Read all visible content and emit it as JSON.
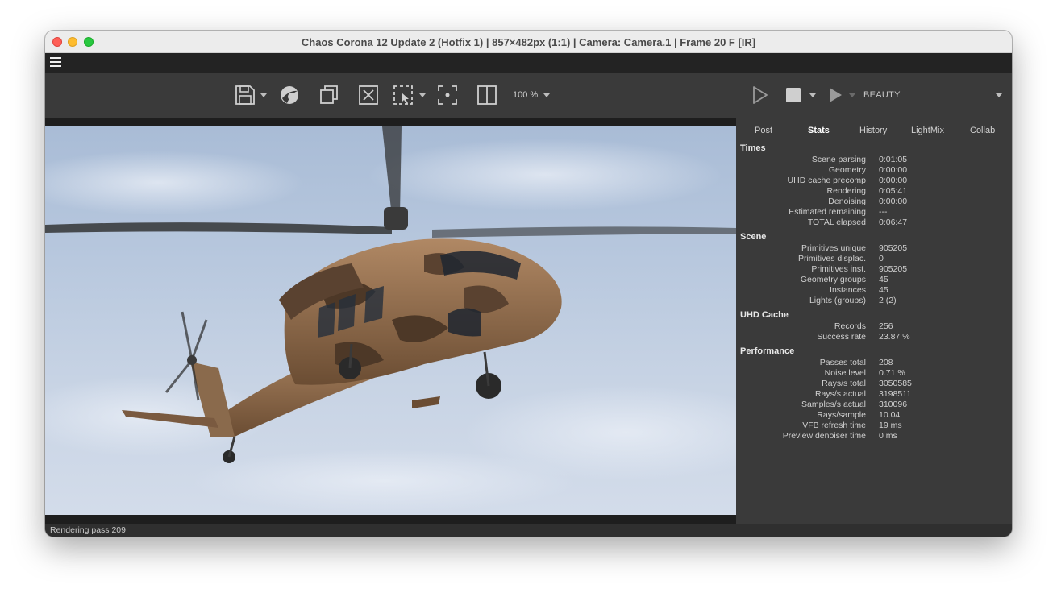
{
  "window": {
    "title": "Chaos Corona 12 Update 2 (Hotfix 1) | 857×482px (1:1) | Camera: Camera.1 | Frame 20 F [IR]"
  },
  "toolbar": {
    "icons": [
      "save-icon",
      "corona-logo-icon",
      "copy-icon",
      "clear-icon",
      "region-select-icon",
      "focus-point-icon",
      "split-view-icon"
    ],
    "zoom": "100 %",
    "render_icons": [
      "play-outline-icon",
      "stop-icon",
      "play-icon"
    ],
    "pass": "BEAUTY"
  },
  "tabs": [
    {
      "label": "Post",
      "active": false
    },
    {
      "label": "Stats",
      "active": true
    },
    {
      "label": "History",
      "active": false
    },
    {
      "label": "LightMix",
      "active": false
    },
    {
      "label": "Collab",
      "active": false
    }
  ],
  "stats": {
    "times": {
      "title": "Times",
      "rows": [
        {
          "label": "Scene parsing",
          "value": "0:01:05"
        },
        {
          "label": "Geometry",
          "value": "0:00:00"
        },
        {
          "label": "UHD cache precomp",
          "value": "0:00:00"
        },
        {
          "label": "Rendering",
          "value": "0:05:41"
        },
        {
          "label": "Denoising",
          "value": "0:00:00"
        },
        {
          "label": "Estimated remaining",
          "value": "---"
        },
        {
          "label": "TOTAL elapsed",
          "value": "0:06:47"
        }
      ]
    },
    "scene": {
      "title": "Scene",
      "rows": [
        {
          "label": "Primitives unique",
          "value": "905205"
        },
        {
          "label": "Primitives displac.",
          "value": "0"
        },
        {
          "label": "Primitives inst.",
          "value": "905205"
        },
        {
          "label": "Geometry groups",
          "value": "45"
        },
        {
          "label": "Instances",
          "value": "45"
        },
        {
          "label": "Lights (groups)",
          "value": "2 (2)"
        }
      ]
    },
    "uhd": {
      "title": "UHD Cache",
      "rows": [
        {
          "label": "Records",
          "value": "256"
        },
        {
          "label": "Success rate",
          "value": "23.87 %"
        }
      ]
    },
    "performance": {
      "title": "Performance",
      "rows": [
        {
          "label": "Passes total",
          "value": "208"
        },
        {
          "label": "Noise level",
          "value": "0.71 %"
        },
        {
          "label": "Rays/s total",
          "value": "3050585"
        },
        {
          "label": "Rays/s actual",
          "value": "3198511"
        },
        {
          "label": "Samples/s actual",
          "value": "310096"
        },
        {
          "label": "Rays/sample",
          "value": "10.04"
        },
        {
          "label": "VFB refresh time",
          "value": "19 ms"
        },
        {
          "label": "Preview denoiser time",
          "value": "0 ms"
        }
      ]
    }
  },
  "status": {
    "text": "Rendering pass 209"
  }
}
